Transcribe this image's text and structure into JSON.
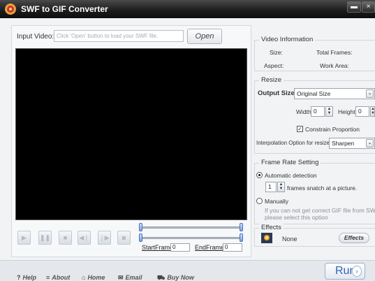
{
  "window": {
    "title": "SWF to GIF Converter"
  },
  "input": {
    "label": "Input Video:",
    "placeholder": "Click 'Open' button to load your SWF file.",
    "open_label": "Open"
  },
  "timeline": {
    "start_label": "StartFrame:",
    "start_value": "0",
    "end_label": "EndFrame:",
    "end_value": "0"
  },
  "video_info": {
    "title": "Video Information",
    "size_label": "Size:",
    "total_frames_label": "Total Frames:",
    "aspect_label": "Aspect:",
    "work_area_label": "Work Area:"
  },
  "resize": {
    "title": "Resize",
    "output_size_label": "Output Size:",
    "output_size_value": "Original Size",
    "width_label": "Width:",
    "width_value": "0",
    "height_label": "Height:",
    "height_value": "0",
    "constrain_label": "Constrain Proportion",
    "constrain_checked": true,
    "interp_label": "Interpolation Option for resize:",
    "interp_value": "Sharpen"
  },
  "frame_rate": {
    "title": "Frame Rate Setting",
    "auto_label": "Automatic detection",
    "snatch_value": "1",
    "snatch_label": "frames snatch at a picture.",
    "manual_label": "Manually",
    "manual_hint_1": "If you can not get correct GIF file from SWF,",
    "manual_hint_2": "please select this option"
  },
  "effects": {
    "title": "Effects",
    "value": "None",
    "button_label": "Effects"
  },
  "bottom": {
    "help": "Help",
    "about": "About",
    "home": "Home",
    "email": "Email",
    "buy": "Buy Now",
    "run": "Run"
  },
  "colors": {
    "accent": "#2d64b0",
    "titlebar": "#1e1e1e",
    "video_bg": "#000000"
  }
}
